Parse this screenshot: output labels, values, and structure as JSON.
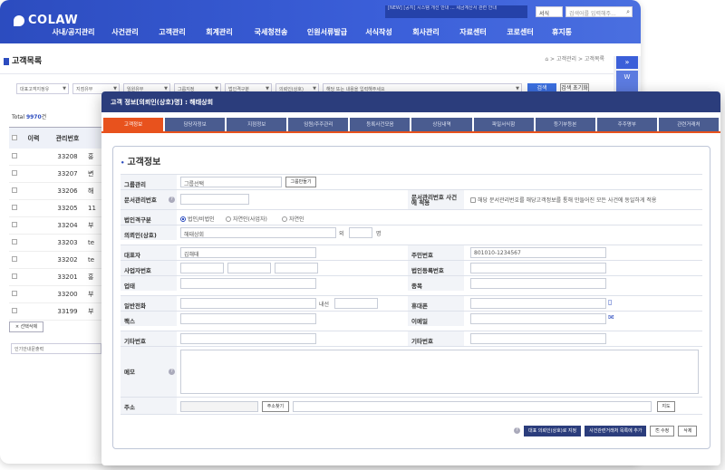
{
  "brand": {
    "name": "COLAW"
  },
  "topnav": [
    "사내/공지관리",
    "사건관리",
    "고객관리",
    "회계관리",
    "국세청전송",
    "인원서류발급",
    "서식작성",
    "회사관리",
    "자료센터",
    "코로센터",
    "휴지통"
  ],
  "notice": "[NEW] [공지] 시스템 개선 안내 ... 세금계산서 관련 안내",
  "sys_select": "서식",
  "top_search_placeholder": "검색어를 입력해주...",
  "page": {
    "title": "고객목록",
    "breadcrumb": "⌂ > 고객관리 > 고객목록"
  },
  "filters": [
    "대표고객지정유",
    "지점유무",
    "임원유무",
    "그룹지정",
    "법인격구분",
    "의뢰인(상호)",
    "해당 또는 내용을 입력해주세요"
  ],
  "search_btn": "검색",
  "reset_btn": "검색 초기화",
  "total": {
    "label": "Total",
    "count": "9970",
    "unit": "건"
  },
  "table": {
    "headers": [
      "이력",
      "관리번호"
    ],
    "rows": [
      [
        "33208",
        "홍"
      ],
      [
        "33207",
        "변"
      ],
      [
        "33206",
        "해"
      ],
      [
        "33205",
        "11"
      ],
      [
        "33204",
        "부"
      ],
      [
        "33203",
        "te"
      ],
      [
        "33202",
        "te"
      ],
      [
        "33201",
        "홍"
      ],
      [
        "33200",
        "부"
      ],
      [
        "33199",
        "부"
      ]
    ]
  },
  "delete_selected": "× 선택삭제",
  "print_select": "인기안내문출력",
  "rightstrip": {
    "arrow": "»",
    "label": "W"
  },
  "modal": {
    "title": "고객 정보[의뢰인(상호)명] : 해태상회",
    "tabs": [
      "고객정보",
      "담당자정보",
      "지점정보",
      "임원/주주관리",
      "등록사건모음",
      "상담내역",
      "파일서식함",
      "등기부등본",
      "주주명부",
      "관련거래처"
    ],
    "section": "고객정보",
    "group_label": "그룹관리",
    "group_select": "그룹선택",
    "group_btn": "그룹만들기",
    "docno_label": "문서관리번호",
    "apply_label": "문서관리번호 사건에 적용",
    "apply_text": "해당 문서관리번호를 해당고객정보를 통해 만들어진 모든 사건에 동일하게 적용",
    "corp_label": "법인격구분",
    "corp_opts": [
      "법인/비법인",
      "자연인(사업자)",
      "자연인"
    ],
    "client_label": "의뢰인(상호)",
    "client_value": "해태상회",
    "outside": "외",
    "people": "명",
    "rep_label": "대표자",
    "rep_value": "김해태",
    "resid_label": "주민번호",
    "resid_value": "801010-1234567",
    "biz_label": "사업자번호",
    "corpno_label": "법인등록번호",
    "type_label": "업태",
    "item_label": "종목",
    "phone_label": "일반전화",
    "ext": "내선",
    "mobile_label": "휴대폰",
    "fax_label": "팩스",
    "email_label": "이메일",
    "etc1_label": "기타번호",
    "etc2_label": "기타번호",
    "memo_label": "메모",
    "addr_label": "주소",
    "addr_btn": "주소찾기",
    "map_btn": "지도",
    "foot_btns": [
      "대표 의뢰인(상호)로 지정",
      "사건관련거래처 목록에 추가",
      "⎘ 수정",
      "삭제"
    ]
  }
}
